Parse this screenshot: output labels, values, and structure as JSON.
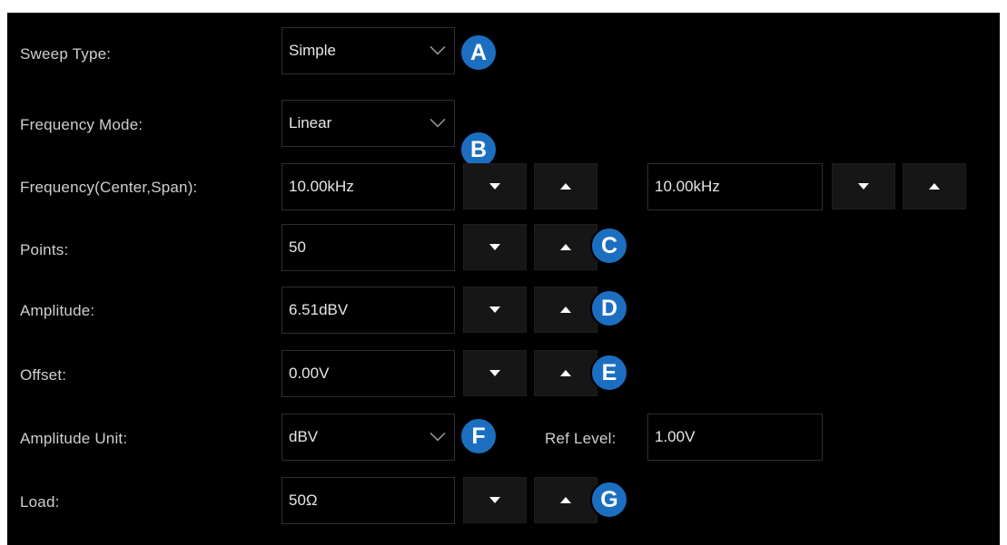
{
  "rows": {
    "sweep_type": {
      "label": "Sweep Type:",
      "value": "Simple",
      "badge": "A"
    },
    "frequency_mode": {
      "label": "Frequency Mode:",
      "value": "Linear",
      "badge": "B"
    },
    "frequency": {
      "label": "Frequency(Center,Span):",
      "center": "10.00kHz",
      "span": "10.00kHz"
    },
    "points": {
      "label": "Points:",
      "value": "50",
      "badge": "C"
    },
    "amplitude": {
      "label": "Amplitude:",
      "value": "6.51dBV",
      "badge": "D"
    },
    "offset": {
      "label": "Offset:",
      "value": "0.00V",
      "badge": "E"
    },
    "amplitude_unit": {
      "label": "Amplitude Unit:",
      "value": "dBV",
      "badge": "F",
      "ref_label": "Ref Level:",
      "ref_value": "1.00V"
    },
    "load": {
      "label": "Load:",
      "value": "50Ω",
      "badge": "G"
    }
  },
  "colors": {
    "badge": "#1c6fc0",
    "panel": "#000000",
    "button": "#161616"
  }
}
